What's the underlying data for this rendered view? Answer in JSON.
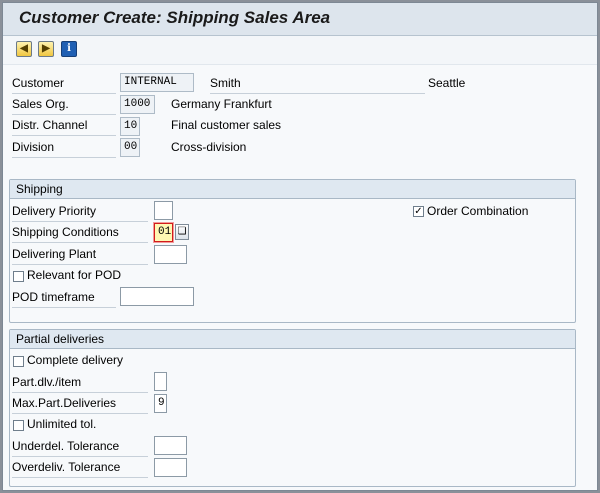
{
  "title": "Customer Create: Shipping Sales Area",
  "toolbar": [
    {
      "icon": "previous-screen-icon"
    },
    {
      "icon": "next-screen-icon"
    },
    {
      "icon": "info-icon",
      "glyph": "i"
    }
  ],
  "header": {
    "customer": {
      "label": "Customer",
      "value": "INTERNAL",
      "name": "Smith",
      "city": "Seattle"
    },
    "sales_org": {
      "label": "Sales Org.",
      "value": "1000",
      "desc": "Germany Frankfurt"
    },
    "distr_channel": {
      "label": "Distr. Channel",
      "value": "10",
      "desc": "Final customer sales"
    },
    "division": {
      "label": "Division",
      "value": "00",
      "desc": "Cross-division"
    }
  },
  "shipping": {
    "title": "Shipping",
    "delivery_priority": {
      "label": "Delivery Priority",
      "value": ""
    },
    "order_combination": {
      "label": "Order Combination",
      "checked": true
    },
    "shipping_conditions": {
      "label": "Shipping Conditions",
      "value": "01"
    },
    "delivering_plant": {
      "label": "Delivering Plant",
      "value": ""
    },
    "relevant_pod": {
      "label": "Relevant for POD",
      "checked": false
    },
    "pod_timeframe": {
      "label": "POD timeframe",
      "value": ""
    }
  },
  "partial": {
    "title": "Partial deliveries",
    "complete_delivery": {
      "label": "Complete delivery",
      "checked": false
    },
    "part_dlv_item": {
      "label": "Part.dlv./item",
      "value": ""
    },
    "max_part_deliveries": {
      "label": "Max.Part.Deliveries",
      "value": "9"
    },
    "unlimited_tol": {
      "label": "Unlimited tol.",
      "checked": false
    },
    "underdel_tolerance": {
      "label": "Underdel. Tolerance",
      "value": ""
    },
    "overdeliv_tolerance": {
      "label": "Overdeliv. Tolerance",
      "value": ""
    }
  },
  "colors": {
    "title_bg": "#dde5ed",
    "group_head": "#dfe8f1",
    "focus_field": "#fff7b3",
    "focus_border": "#d11b1b"
  }
}
